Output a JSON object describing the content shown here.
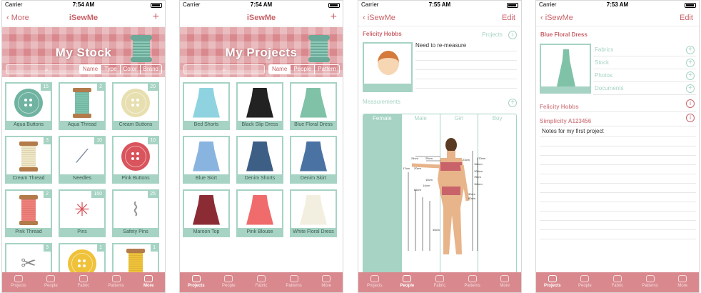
{
  "status": {
    "carrier": "Carrier",
    "times": [
      "7:54 AM",
      "7:54 AM",
      "7:55 AM",
      "7:53 AM"
    ]
  },
  "screen1": {
    "back": "More",
    "title": "iSewMe",
    "plus": "+",
    "banner": "My Stock",
    "segments": [
      "Name",
      "Type",
      "Color",
      "Brand"
    ],
    "items": [
      {
        "label": "Aqua Buttons",
        "count": "15",
        "kind": "button",
        "color": "#6fb3a0"
      },
      {
        "label": "Aqua Thread",
        "count": "2",
        "kind": "spool",
        "color": "#7dc3ae"
      },
      {
        "label": "Cream Buttons",
        "count": "20",
        "kind": "button",
        "color": "#e8dfb0"
      },
      {
        "label": "Cream Thread",
        "count": "3",
        "kind": "spool",
        "color": "#efe6c4"
      },
      {
        "label": "Needles",
        "count": "10",
        "kind": "needles",
        "color": "#7a8aa0"
      },
      {
        "label": "Pink Buttons",
        "count": "10",
        "kind": "button",
        "color": "#d9545c"
      },
      {
        "label": "Pink Thread",
        "count": "2",
        "kind": "spool",
        "color": "#f07f7a"
      },
      {
        "label": "Pins",
        "count": "150",
        "kind": "pins",
        "color": "#333"
      },
      {
        "label": "Safety Pins",
        "count": "25",
        "kind": "safety",
        "color": "#999"
      },
      {
        "label": "",
        "count": "3",
        "kind": "scissors",
        "color": "#888"
      },
      {
        "label": "",
        "count": "1",
        "kind": "button",
        "color": "#efc23a"
      },
      {
        "label": "",
        "count": "1",
        "kind": "spool",
        "color": "#efc23a"
      }
    ],
    "tabs": [
      "Projects",
      "People",
      "Fabric",
      "Patterns",
      "More"
    ],
    "active_tab": 4
  },
  "screen2": {
    "title": "iSewMe",
    "plus": "+",
    "banner": "My Projects",
    "segments": [
      "Name",
      "People",
      "Pattern"
    ],
    "items": [
      {
        "label": "Bed Shorts",
        "color": "#8fd3e0"
      },
      {
        "label": "Black Slip Dress",
        "color": "#222"
      },
      {
        "label": "Blue Floral Dress",
        "color": "#7fc2a8"
      },
      {
        "label": "Blue Skirt",
        "color": "#8ab4e0"
      },
      {
        "label": "Denim Shorts",
        "color": "#3d5f86"
      },
      {
        "label": "Denim Skirt",
        "color": "#4a73a3"
      },
      {
        "label": "Maroon Top",
        "color": "#8b2c35"
      },
      {
        "label": "Pink Blouse",
        "color": "#f06b6b"
      },
      {
        "label": "White Floral Dress",
        "color": "#f2efe0"
      }
    ],
    "tabs": [
      "Projects",
      "People",
      "Fabric",
      "Patterns",
      "More"
    ],
    "active_tab": 0
  },
  "screen3": {
    "back": "iSewMe",
    "edit": "Edit",
    "name": "Felicity Hobbs",
    "projects_label": "Projects",
    "note": "Need to re-measure",
    "measurements_label": "Measurements",
    "segments": [
      "Female",
      "Male",
      "Girl",
      "Boy"
    ],
    "measures": [
      "24cm",
      "25cm",
      "23cm",
      "170cm",
      "116cm",
      "100cm",
      "75cm",
      "17cm",
      "20cm",
      "110cm",
      "10cm",
      "14cm",
      "85cm",
      "90cm",
      "80cm",
      "45cm"
    ],
    "tabs": [
      "Projects",
      "People",
      "Fabric",
      "Patterns",
      "More"
    ],
    "active_tab": 1
  },
  "screen4": {
    "back": "iSewMe",
    "edit": "Edit",
    "project": "Blue Floral Dress",
    "rows": [
      "Fabrics",
      "Stock",
      "Photos",
      "Documents"
    ],
    "person": "Felicity Hobbs",
    "pattern": "Simplicity A123456",
    "notes": "Notes for my first project",
    "tabs": [
      "Projects",
      "People",
      "Fabric",
      "Patterns",
      "More"
    ],
    "active_tab": 0
  },
  "colors": {
    "accent": "#c9636a",
    "mint": "#a6d3c3",
    "banner": "#d9898e"
  }
}
